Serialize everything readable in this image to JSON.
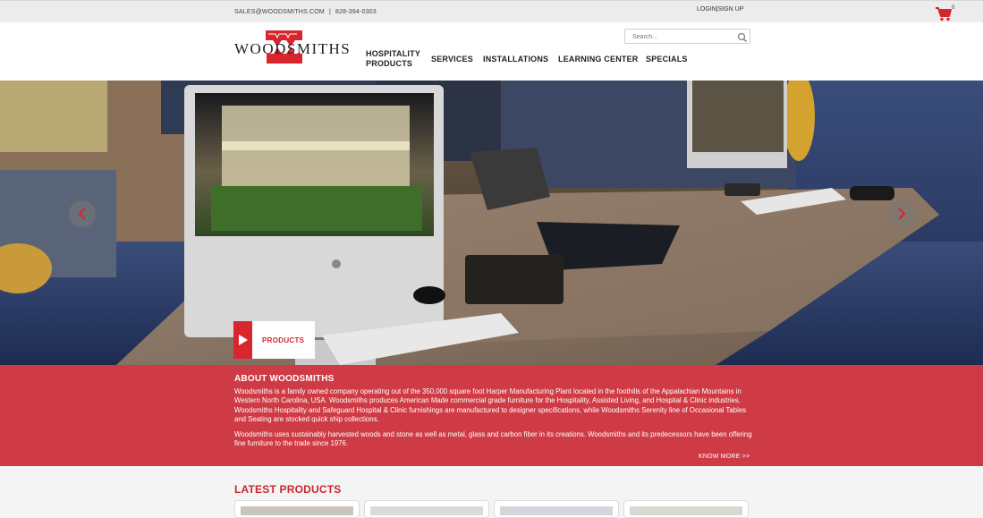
{
  "topbar": {
    "email": "SALES@WOODSMITHS.COM",
    "separator": "|",
    "phone": "828-394-0303",
    "login": "LOGIN",
    "auth_sep": "|",
    "signup": "SIGN UP",
    "cart_count": "0",
    "cart_icon": "shopping-cart-icon"
  },
  "header": {
    "logo_text": "WOODSMITHS",
    "search_placeholder": "Search...",
    "search_icon": "magnifier-icon",
    "nav": [
      {
        "label_line1": "HOSPITALITY",
        "label_line2": "PRODUCTS"
      },
      {
        "label_line1": "SERVICES"
      },
      {
        "label_line1": "INSTALLATIONS"
      },
      {
        "label_line1": "LEARNING CENTER"
      },
      {
        "label_line1": "SPECIALS"
      }
    ]
  },
  "hero": {
    "cta_label": "PRODUCTS",
    "prev_icon": "chevron-left-icon",
    "next_icon": "chevron-right-icon"
  },
  "about": {
    "title": "ABOUT WOODSMITHS",
    "paragraph1": "Woodsmiths is a family owned company operating out of the 350,000 square foot Harper Manufacturing Plant located in the foothills of the Appalachian Mountains in Western North Carolina, USA. Woodsmiths produces American Made commercial grade furniture for the Hospitality, Assisted Living, and Hospital & Clinic industries. Woodsmiths Hospitality and Safeguard Hospital & Clinic furnishings are manufactured to designer specifications, while Woodsmiths Serenity line of Occasional Tables and Seating are stocked quick ship collections.",
    "paragraph2": "Woodsmiths uses sustainably harvested woods and stone as well as metal, glass and carbon fiber in its creations. Woodsmiths and its predecessors have been offering fine furniture to the trade since 1976.",
    "know_more": "KNOW MORE >>"
  },
  "latest": {
    "title": "LATEST PRODUCTS"
  },
  "colors": {
    "brand_red": "#cf3b44",
    "accent_red": "#d9262e",
    "cart_red": "#d6262d"
  }
}
